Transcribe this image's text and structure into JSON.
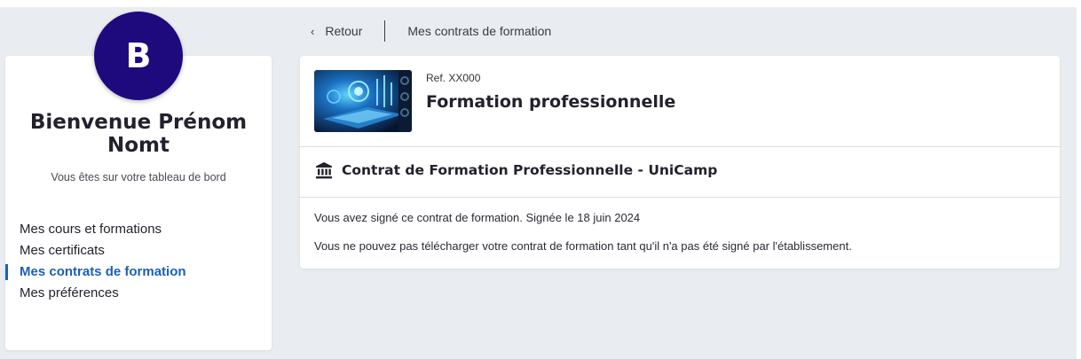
{
  "profile": {
    "avatar_initial": "B",
    "welcome": "Bienvenue Prénom Nomt",
    "subtitle": "Vous êtes sur votre tableau de bord"
  },
  "sidebar": {
    "items": [
      {
        "label": "Mes cours et formations",
        "active": false
      },
      {
        "label": "Mes certificats",
        "active": false
      },
      {
        "label": "Mes contrats de formation",
        "active": true
      },
      {
        "label": "Mes préférences",
        "active": false
      }
    ]
  },
  "breadcrumb": {
    "back_label": "Retour",
    "current": "Mes contrats de formation"
  },
  "course": {
    "ref": "Ref. XX000",
    "title": "Formation professionnelle"
  },
  "contract": {
    "icon": "bank-icon",
    "title": "Contrat de Formation Professionnelle - UniCamp",
    "signed_message": "Vous avez signé ce contrat de formation. Signée le 18 juin 2024",
    "download_message": "Vous ne pouvez pas télécharger votre contrat de formation tant qu'il n'a pas été signé par l'établissement."
  },
  "colors": {
    "background": "#e9edf1",
    "avatar": "#1e0a7d",
    "active_nav": "#1d5fb8",
    "text": "#22222e"
  }
}
